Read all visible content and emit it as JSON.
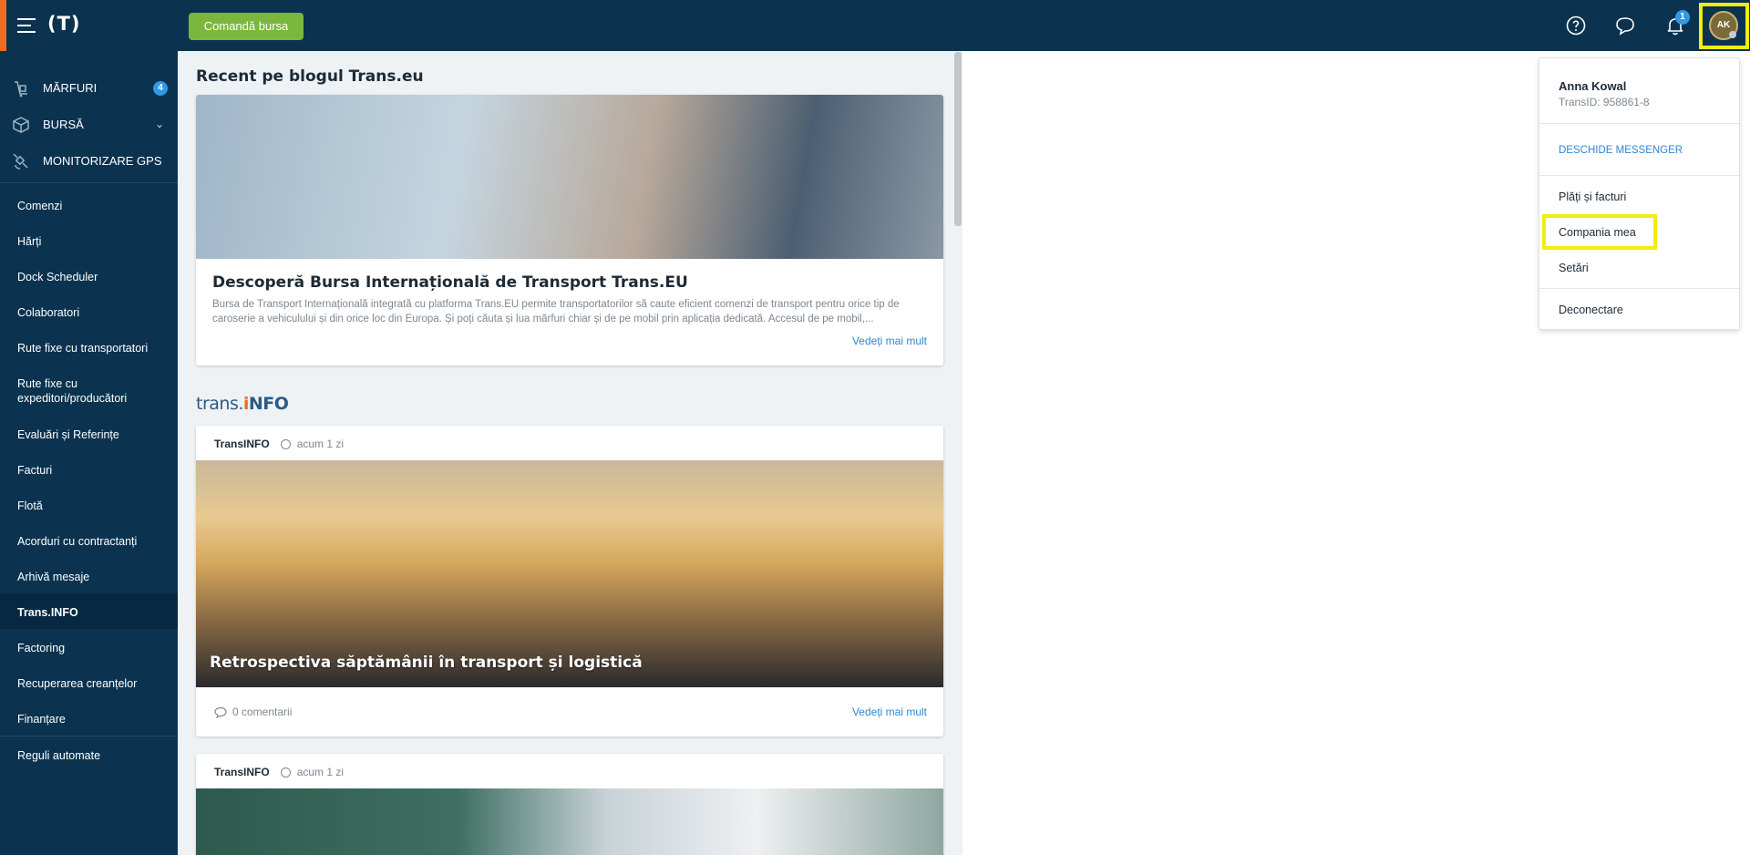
{
  "header": {
    "logo": "(T)",
    "cta_label": "Comandă bursa",
    "notifications_count": "1",
    "avatar_initials": "AK"
  },
  "sidebar": {
    "top_items": [
      {
        "label": "MĂRFURI",
        "icon": "cargo-icon",
        "badge": "4"
      },
      {
        "label": "BURSĂ",
        "icon": "box-icon"
      },
      {
        "label": "MONITORIZARE GPS",
        "icon": "satellite-icon"
      }
    ],
    "items": [
      {
        "label": "Comenzi"
      },
      {
        "label": "Hărți"
      },
      {
        "label": "Dock Scheduler"
      },
      {
        "label": "Colaboratori"
      },
      {
        "label": "Rute fixe cu transportatori"
      },
      {
        "label": "Rute fixe cu expeditori/producători"
      },
      {
        "label": "Evaluări și Referințe"
      },
      {
        "label": "Facturi"
      },
      {
        "label": "Flotă"
      },
      {
        "label": "Acorduri cu contractanți"
      },
      {
        "label": "Arhivă mesaje"
      },
      {
        "label": "Trans.INFO"
      },
      {
        "label": "Factoring"
      },
      {
        "label": "Recuperarea creanțelor"
      },
      {
        "label": "Finanțare"
      },
      {
        "label": "Reguli automate"
      }
    ]
  },
  "feed": {
    "blog_section_title": "Recent pe blogul Trans.eu",
    "blog_card": {
      "title": "Descoperă Bursa Internațională de Transport Trans.EU",
      "description": "Bursa de Transport Internațională integrată cu platforma Trans.EU permite transportatorilor să caute eficient comenzi de transport pentru orice tip de caroserie a vehiculului și din orice loc din Europa. Și poți căuta și lua mărfuri chiar și de pe mobil prin aplicația dedicată. Accesul de pe mobil,...",
      "more_label": "Vedeți mai mult"
    },
    "transinfo_logo": {
      "a": "trans.",
      "b": "i",
      "c": "NFO"
    },
    "news": [
      {
        "source": "TransINFO",
        "time": "acum 1 zi",
        "title": "Retrospectiva săptămânii în transport și logistică",
        "comments": "0 comentarii",
        "more_label": "Vedeți mai mult"
      },
      {
        "source": "TransINFO",
        "time": "acum 1 zi"
      }
    ]
  },
  "user_menu": {
    "name": "Anna Kowal",
    "trans_id": "TransID: 958861-8",
    "messenger": "DESCHIDE MESSENGER",
    "items": [
      "Plăți și facturi",
      "Compania mea",
      "Setări"
    ],
    "logout": "Deconectare"
  },
  "colors": {
    "navy": "#0b3350",
    "green": "#7bb73c",
    "blue": "#2f9ae6",
    "highlight": "#f4ec12"
  }
}
